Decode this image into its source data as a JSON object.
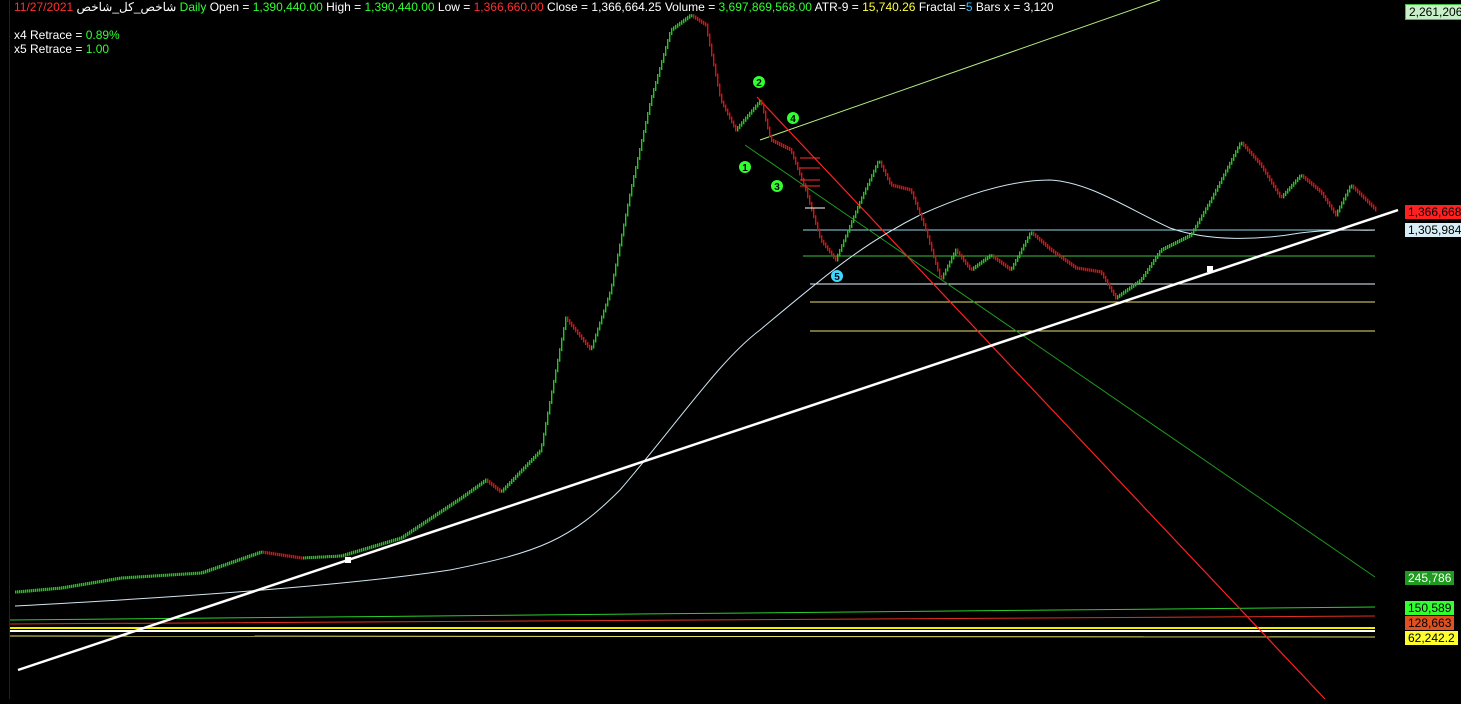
{
  "header": {
    "symbol": "شاخص_کل_شاخص",
    "date": "11/27/2021",
    "interval": "Daily",
    "open_label": "Open = ",
    "open": "1,390,440.00",
    "high_label": "High = ",
    "high": "1,390,440.00",
    "low_label": "Low = ",
    "low": "1,366,660.00",
    "close_label": "Close = ",
    "close": "1,366,664.25",
    "volume_label": "Volume = ",
    "volume": "3,697,869,568.00",
    "atr_label": "ATR-9 = ",
    "atr": "15,740.26",
    "fractal_label": "Fractal =",
    "fractal": "5",
    "bars_label": "Bars  x = ",
    "bars": "3,120"
  },
  "retrace": {
    "x4_label": "x4 Retrace = ",
    "x4_value": "0.89%",
    "x5_label": "x5 Retrace = ",
    "x5_value": "1.00"
  },
  "price_tags": {
    "top": "2,261,206",
    "current": "1,366,668",
    "ma": "1,305,984",
    "t1": "245,786",
    "t2": "150,589",
    "t3": "128,663",
    "t4": "62,242.2"
  },
  "wave_labels": [
    "1",
    "2",
    "3",
    "4",
    "5"
  ],
  "colors": {
    "up": "#1ec81e",
    "down": "#e01010",
    "ma": "#d0e6f0",
    "trend": "#ffffff",
    "channel_red": "#ff2020",
    "channel_green": "#1e9a1e",
    "channel_light": "#b8f080"
  }
}
